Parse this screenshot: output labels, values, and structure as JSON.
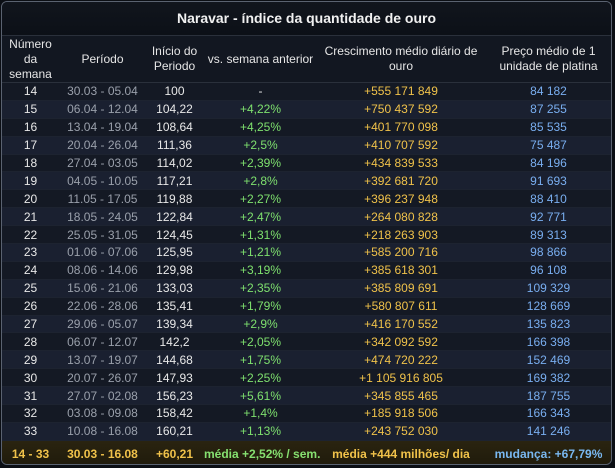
{
  "title": "Naravar - índice da quantidade de ouro",
  "columns": [
    "Número da semana",
    "Período",
    "Início do Periodo",
    "vs. semana anterior",
    "Crescimento médio diário de ouro",
    "Preço médio de 1 unidade de platina"
  ],
  "rows": [
    [
      "14",
      "30.03 - 05.04",
      "100",
      "-",
      "+555 171 849",
      "84 182"
    ],
    [
      "15",
      "06.04 - 12.04",
      "104,22",
      "+4,22%",
      "+750 437 592",
      "87 255"
    ],
    [
      "16",
      "13.04 - 19.04",
      "108,64",
      "+4,25%",
      "+401 770 098",
      "85 535"
    ],
    [
      "17",
      "20.04 - 26.04",
      "111,36",
      "+2,5%",
      "+410 707 592",
      "75 487"
    ],
    [
      "18",
      "27.04 - 03.05",
      "114,02",
      "+2,39%",
      "+434 839 533",
      "84 196"
    ],
    [
      "19",
      "04.05 - 10.05",
      "117,21",
      "+2,8%",
      "+392 681 720",
      "91 693"
    ],
    [
      "20",
      "11.05 - 17.05",
      "119,88",
      "+2,27%",
      "+396 237 948",
      "88 410"
    ],
    [
      "21",
      "18.05 - 24.05",
      "122,84",
      "+2,47%",
      "+264 080 828",
      "92 771"
    ],
    [
      "22",
      "25.05 - 31.05",
      "124,45",
      "+1,31%",
      "+218 263 903",
      "89 313"
    ],
    [
      "23",
      "01.06 - 07.06",
      "125,95",
      "+1,21%",
      "+585 200 716",
      "98 866"
    ],
    [
      "24",
      "08.06 - 14.06",
      "129,98",
      "+3,19%",
      "+385 618 301",
      "96 108"
    ],
    [
      "25",
      "15.06 - 21.06",
      "133,03",
      "+2,35%",
      "+385 809 691",
      "109 329"
    ],
    [
      "26",
      "22.06 - 28.06",
      "135,41",
      "+1,79%",
      "+580 807 611",
      "128 669"
    ],
    [
      "27",
      "29.06 - 05.07",
      "139,34",
      "+2,9%",
      "+416 170 552",
      "135 823"
    ],
    [
      "28",
      "06.07 - 12.07",
      "142,2",
      "+2,05%",
      "+342 092 592",
      "166 398"
    ],
    [
      "29",
      "13.07 - 19.07",
      "144,68",
      "+1,75%",
      "+474 720 222",
      "152 469"
    ],
    [
      "30",
      "20.07 - 26.07",
      "147,93",
      "+2,25%",
      "+1 105 916 805",
      "169 382"
    ],
    [
      "31",
      "27.07 - 02.08",
      "156,23",
      "+5,61%",
      "+345 855 465",
      "187 755"
    ],
    [
      "32",
      "03.08 - 09.08",
      "158,42",
      "+1,4%",
      "+185 918 506",
      "166 343"
    ],
    [
      "33",
      "10.08 - 16.08",
      "160,21",
      "+1,13%",
      "+243 752 030",
      "141 246"
    ]
  ],
  "footer": {
    "weeks": "14 - 33",
    "period": "30.03 - 16.08",
    "index_change": "+60,21",
    "avg_weekly": "média +2,52% / sem.",
    "avg_daily": "média +444 milhões/ dia",
    "price_change": "mudança: +67,79%"
  },
  "colors": {
    "green": "#7ee06e",
    "gold": "#f0c24a",
    "blue": "#79aef0",
    "footer_bg": "#2a2410"
  }
}
